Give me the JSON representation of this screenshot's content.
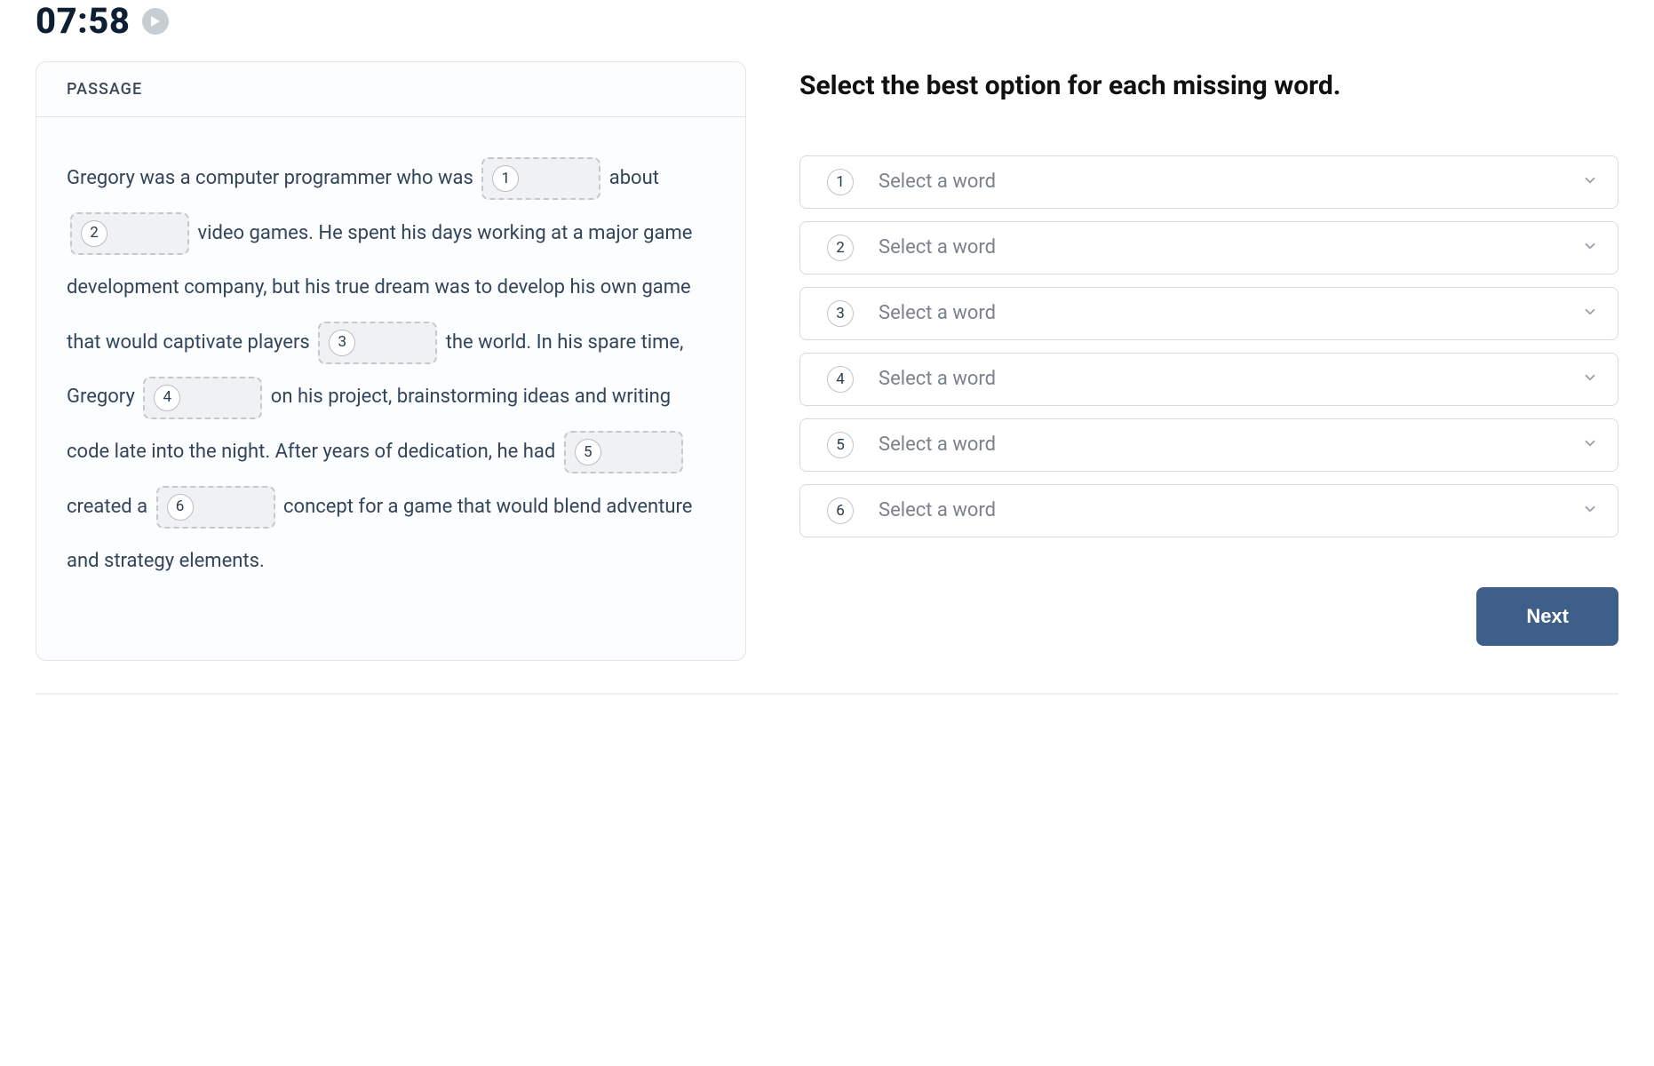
{
  "timer": "07:58",
  "passage_label": "PASSAGE",
  "passage_segments": [
    {
      "type": "text",
      "value": "Gregory was a computer programmer who was "
    },
    {
      "type": "blank",
      "num": "1"
    },
    {
      "type": "text",
      "value": " about "
    },
    {
      "type": "blank",
      "num": "2"
    },
    {
      "type": "text",
      "value": " video games. He spent his days working at a major game development company, but his true dream was to develop his own game that would captivate players "
    },
    {
      "type": "blank",
      "num": "3"
    },
    {
      "type": "text",
      "value": " the world. In his spare time, Gregory "
    },
    {
      "type": "blank",
      "num": "4"
    },
    {
      "type": "text",
      "value": " on his project, brainstorming ideas and writing code late into the night. After years of dedication, he had "
    },
    {
      "type": "blank",
      "num": "5"
    },
    {
      "type": "text",
      "value": " created a "
    },
    {
      "type": "blank",
      "num": "6"
    },
    {
      "type": "text",
      "value": " concept for a game that would blend adventure and strategy elements."
    }
  ],
  "instruction": "Select the best option for each missing word.",
  "select_placeholder": "Select a word",
  "selects": [
    {
      "num": "1"
    },
    {
      "num": "2"
    },
    {
      "num": "3"
    },
    {
      "num": "4"
    },
    {
      "num": "5"
    },
    {
      "num": "6"
    }
  ],
  "next_label": "Next"
}
